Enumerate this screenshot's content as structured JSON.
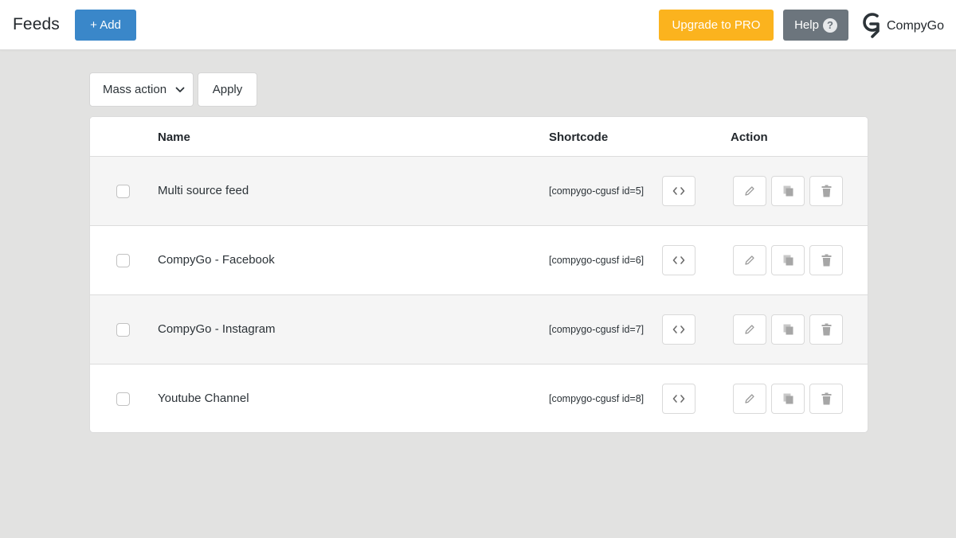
{
  "header": {
    "title": "Feeds",
    "add_label": "+ Add",
    "upgrade_label": "Upgrade to PRO",
    "help_label": "Help",
    "help_icon": "question-circle-icon",
    "brand_name": "CompyGo",
    "brand_icon": "compygo-logo-icon"
  },
  "toolbar": {
    "mass_action_value": "Mass action",
    "apply_label": "Apply"
  },
  "table": {
    "columns": {
      "name": "Name",
      "shortcode": "Shortcode",
      "action": "Action"
    },
    "rows": [
      {
        "name": "Multi source feed",
        "shortcode": "[compygo-cgusf id=5]"
      },
      {
        "name": "CompyGo - Facebook",
        "shortcode": "[compygo-cgusf id=6]"
      },
      {
        "name": "CompyGo - Instagram",
        "shortcode": "[compygo-cgusf id=7]"
      },
      {
        "name": "Youtube Channel",
        "shortcode": "[compygo-cgusf id=8]"
      }
    ]
  },
  "colors": {
    "add_button": "#3a87c9",
    "upgrade_button": "#fbb31e",
    "help_button": "#6c757d",
    "page_background": "#e2e2e1"
  }
}
